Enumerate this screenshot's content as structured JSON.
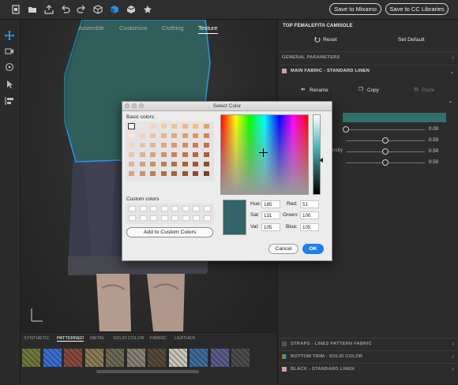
{
  "toolbar": {
    "icons": [
      "new-file-icon",
      "open-folder-icon",
      "export-icon",
      "undo-icon",
      "redo-icon",
      "cube-icon",
      "color-cube-icon",
      "package-icon",
      "star-icon"
    ],
    "save_mixamo": "Save to Mixamo",
    "save_cc": "Save to CC Libraries"
  },
  "leftbar": {
    "icons": [
      "move-icon",
      "camera-icon",
      "target-icon",
      "select-arrow-icon",
      "align-icon"
    ]
  },
  "viewport": {
    "tabs": [
      "Assemble",
      "Customize",
      "Clothing",
      "Texture"
    ],
    "active_tab": "Texture"
  },
  "materials": {
    "tabs": [
      "SYNTHETIC",
      "PATTERNED",
      "METAL",
      "SOLID COLOR",
      "FABRIC",
      "LEATHER"
    ],
    "active_tab": "PATTERNED",
    "swatch_colors": [
      "#6f7a3e",
      "#3c6fd0",
      "#8b4a3a",
      "#8d7e55",
      "#6e6b55",
      "#8a8277",
      "#5a4a3c",
      "#c9c9bf",
      "#3d6e9c",
      "#5a5e8c",
      "#4d4d4d"
    ]
  },
  "panel": {
    "title": "TOP FEMALEFITA CAMISOLE",
    "reset": "Reset",
    "set_default": "Set Default",
    "general_parameters": "GENERAL PARAMETERS",
    "main_fabric": "MAIN FABRIC - STANDARD LINEN",
    "rename": "Rename",
    "copy": "Copy",
    "paste": "Paste",
    "param_partial": "nsity",
    "sliders": [
      {
        "value": "0.00",
        "fraction": 0.0
      },
      {
        "value": "0.50",
        "fraction": 0.5
      },
      {
        "value": "0.50",
        "fraction": 0.5
      },
      {
        "value": "0.50",
        "fraction": 0.5
      }
    ],
    "color_swatch": "#33706a",
    "straps": "STRAPS - LINES PATTERN FABRIC",
    "bottom_trim": "BOTTOM TRIM - SOLID COLOR",
    "black": "BLACK - STANDARD LINEN"
  },
  "dialog": {
    "title": "Select Color",
    "basic_colors": "Basic colors",
    "custom_colors": "Custom colors",
    "add_custom": "Add to Custom Colors",
    "hue_label": "Hue:",
    "hue": "185",
    "sat_label": "Sat:",
    "sat": "131",
    "val_label": "Val:",
    "val": "105",
    "red_label": "Red:",
    "red": "51",
    "green_label": "Green:",
    "green": "100",
    "blue_label": "Blue:",
    "blue": "105",
    "current_color": "#336469",
    "cancel": "Cancel",
    "ok": "OK",
    "basic_palette": [
      [
        "#ffffff",
        "#f2e4da",
        "#f0d5c3",
        "#f5c9a8",
        "#f3c29b",
        "#f0b889",
        "#f6c07c",
        "#e9a26a"
      ],
      [
        "#f7e6dc",
        "#f2d2bf",
        "#edc0a3",
        "#e9b290",
        "#e7a77e",
        "#e49c6d",
        "#e4925d",
        "#d9844f"
      ],
      [
        "#f0d6c4",
        "#ebc4aa",
        "#e6b395",
        "#e1a580",
        "#dc976c",
        "#d88a5c",
        "#d17d4c",
        "#c66f3f"
      ],
      [
        "#e9c5ad",
        "#e2b195",
        "#dc9f7e",
        "#d58f6a",
        "#cd8058",
        "#c67249",
        "#bf653c",
        "#b25a33"
      ],
      [
        "#ddb397",
        "#d39f82",
        "#ca8d6d",
        "#c07c5a",
        "#b76d4b",
        "#ac603e",
        "#a15434",
        "#93492b"
      ],
      [
        "#d4a485",
        "#c9906f",
        "#bc7d5c",
        "#b06d4c",
        "#a35f40",
        "#965335",
        "#894a2f",
        "#7b4028"
      ]
    ]
  }
}
